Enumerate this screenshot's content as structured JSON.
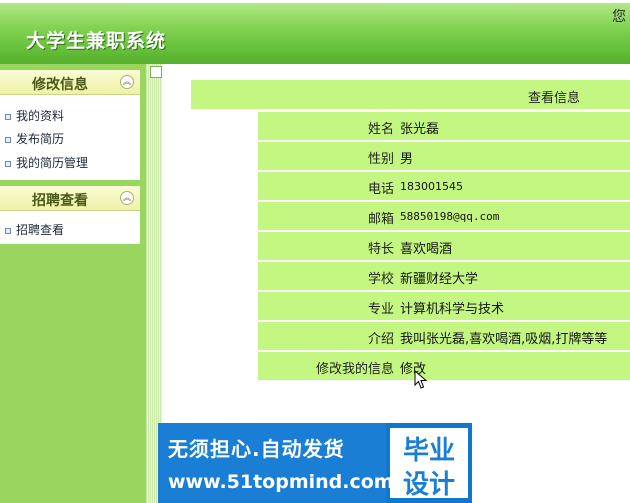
{
  "header": {
    "title": "大学生兼职系统",
    "welcome": "您"
  },
  "sidebar": {
    "panels": [
      {
        "title": "修改信息",
        "collapse_glyph": "︽",
        "items": [
          {
            "label": "我的资料"
          },
          {
            "label": "发布简历"
          },
          {
            "label": "我的简历管理"
          }
        ]
      },
      {
        "title": "招聘查看",
        "collapse_glyph": "︽",
        "items": [
          {
            "label": "招聘查看"
          }
        ]
      }
    ]
  },
  "info": {
    "header": "查看信息",
    "rows": [
      {
        "label": "姓名",
        "value": "张光磊"
      },
      {
        "label": "性别",
        "value": "男"
      },
      {
        "label": "电话",
        "value": "183001545"
      },
      {
        "label": "邮箱",
        "value": "58850198@qq.com"
      },
      {
        "label": "特长",
        "value": "喜欢喝酒"
      },
      {
        "label": "学校",
        "value": "新疆财经大学"
      },
      {
        "label": "专业",
        "value": "计算机科学与技术"
      },
      {
        "label": "介绍",
        "value": "我叫张光磊,喜欢喝酒,吸烟,打牌等等"
      },
      {
        "label": "修改我的信息",
        "value": "修改"
      }
    ]
  },
  "ad": {
    "line1": "无须担心.自动发货",
    "line2": "www.51topmind.com",
    "right_line1": "毕业",
    "right_line2": "设计"
  },
  "icons": {
    "bullet": "square-bullet-icon",
    "collapse": "chevron-up-double-icon",
    "cursor": "mouse-pointer-icon"
  },
  "colors": {
    "header_green": "#55b02c",
    "sidebar_green": "#9ad55f",
    "row_green": "#c4f781",
    "ad_blue": "#1a7fd4"
  }
}
